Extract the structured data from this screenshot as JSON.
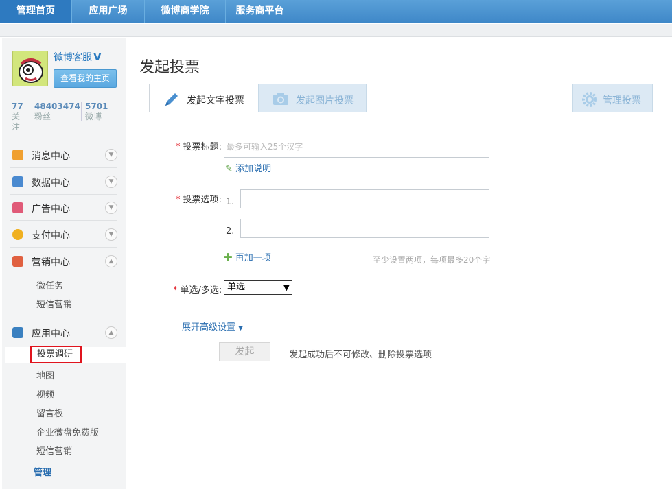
{
  "topnav": {
    "tabs": [
      "管理首页",
      "应用广场",
      "微博商学院",
      "服务商平台"
    ]
  },
  "profile": {
    "name": "微博客服",
    "verified_mark": "V",
    "home_button": "查看我的主页",
    "stats": [
      {
        "value": "77",
        "label": "关注"
      },
      {
        "value": "48403474",
        "label": "粉丝"
      },
      {
        "value": "5701",
        "label": "微博"
      }
    ]
  },
  "sidebar": {
    "menu": [
      {
        "label": "消息中心",
        "icon": "speaker-icon",
        "color": "#f0a030",
        "expanded": false
      },
      {
        "label": "数据中心",
        "icon": "chart-icon",
        "color": "#4a8ad0",
        "expanded": false
      },
      {
        "label": "广告中心",
        "icon": "ad-icon",
        "color": "#e05a78",
        "expanded": false
      },
      {
        "label": "支付中心",
        "icon": "yen-icon",
        "color": "#f0b020",
        "expanded": false
      },
      {
        "label": "营销中心",
        "icon": "bag-icon",
        "color": "#e06040",
        "expanded": true
      },
      {
        "label": "应用中心",
        "icon": "app-icon",
        "color": "#3a80c0",
        "expanded": true
      }
    ],
    "marketing_sub": [
      "微任务",
      "短信营销"
    ],
    "app_sub": [
      "投票调研",
      "地图",
      "视频",
      "留言板",
      "企业微盘免费版",
      "短信营销"
    ],
    "active_sub": "投票调研",
    "manage": "管理"
  },
  "main": {
    "title": "发起投票",
    "tabs": [
      "发起文字投票",
      "发起图片投票",
      "管理投票"
    ],
    "form": {
      "title_label": "投票标题:",
      "title_placeholder": "最多可输入25个汉字",
      "add_desc": "添加说明",
      "options_label": "投票选项:",
      "option_numbers": [
        "1.",
        "2."
      ],
      "add_option": "再加一项",
      "options_hint": "至少设置两项，每项最多20个字",
      "mode_label": "单选/多选:",
      "mode_value": "单选",
      "advanced": "展开高级设置",
      "submit": "发起",
      "submit_note": "发起成功后不可修改、删除投票选项"
    }
  },
  "colors": {
    "nav_blue": "#3f88c8",
    "link_blue": "#2a6eb0",
    "required_red": "#e0141e",
    "highlight_red": "#e0141e"
  }
}
